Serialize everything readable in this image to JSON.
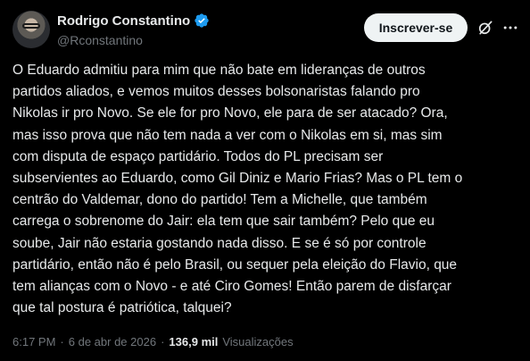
{
  "author": {
    "display_name": "Rodrigo Constantino",
    "handle": "@Rconstantino",
    "verified": true,
    "avatar_icon": "profile-photo"
  },
  "actions": {
    "subscribe_label": "Inscrever-se",
    "grok_icon": "grok-icon",
    "more_icon": "more-dots-icon"
  },
  "tweet": {
    "text": "O Eduardo admitiu para mim que não bate em lideranças de outros\npartidos aliados, e vemos muitos desses bolsonaristas falando pro\nNikolas ir pro Novo. Se ele for pro Novo, ele para de ser atacado? Ora,\nmas isso prova que não tem nada a ver com o Nikolas em si, mas sim\ncom disputa de espaço partidário. Todos do PL precisam ser\nsubservientes ao Eduardo, como Gil Diniz e Mario Frias? Mas o PL tem o\ncentrão do Valdemar, dono do partido! Tem a Michelle, que também\ncarrega o sobrenome do Jair: ela tem que sair também? Pelo que eu\nsoube, Jair não estaria gostando nada disso. E se é só por controle\npartidário, então não é pelo Brasil, ou sequer pela eleição do Flavio, que\ntem alianças com o Novo - e até Ciro Gomes! Então parem de disfarçar\nque tal postura é patriótica, talquei?"
  },
  "meta": {
    "time": "6:17 PM",
    "separator": "·",
    "date": "6 de abr de 2026",
    "views_count": "136,9 mil",
    "views_label": "Visualizações"
  },
  "colors": {
    "background": "#000000",
    "text": "#e7e9ea",
    "muted": "#71767b",
    "verified_badge": "#1d9bf0",
    "button_bg": "#eff3f4"
  }
}
